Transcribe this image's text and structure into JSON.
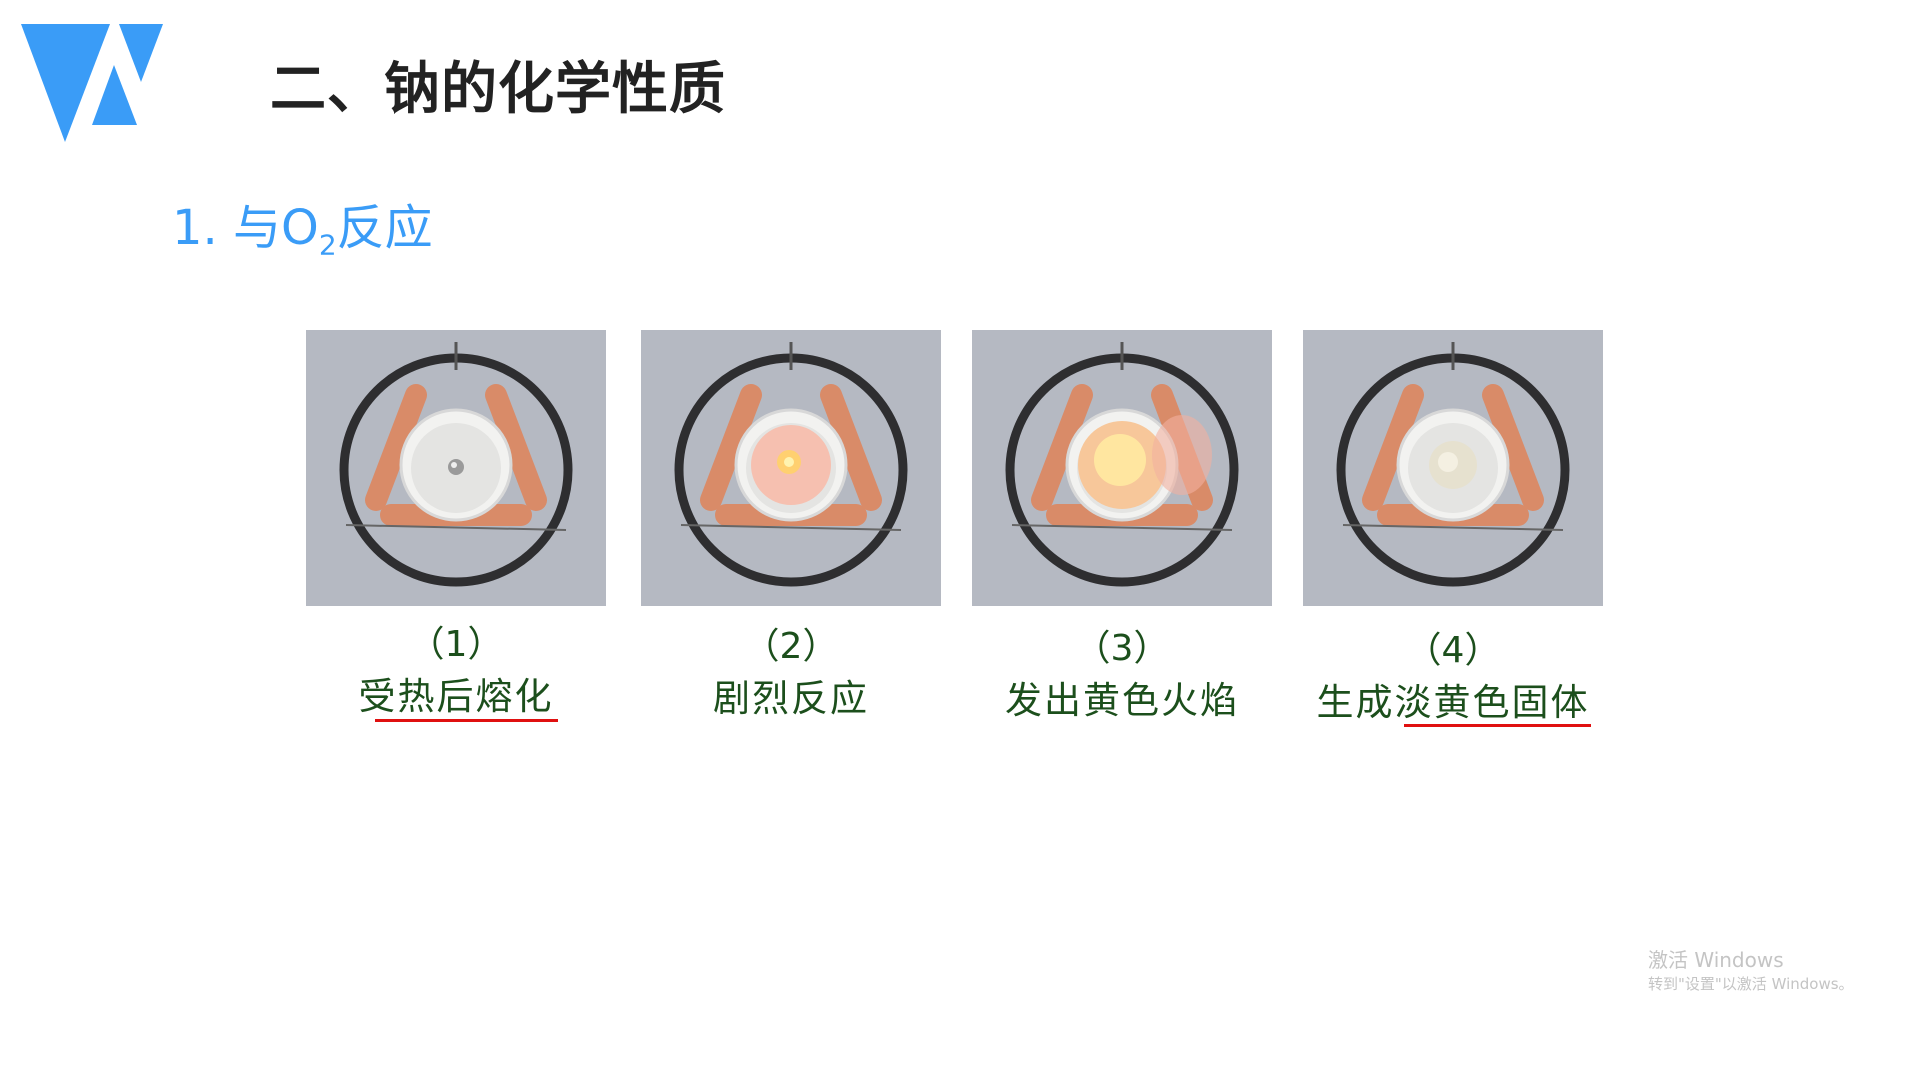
{
  "header": {
    "title": "二、钠的化学性质",
    "logo": "triangle-logo",
    "logo_color": "#3a9cf7"
  },
  "section": {
    "prefix": "1. 与O",
    "sub": "2",
    "suffix": "反应"
  },
  "steps": [
    {
      "number": "（1）",
      "caption": "受热后熔化",
      "state": "melted"
    },
    {
      "number": "（2）",
      "caption": "剧烈反应",
      "state": "reacting"
    },
    {
      "number": "（3）",
      "caption": "发出黄色火焰",
      "state": "flame"
    },
    {
      "number": "（4）",
      "caption": "生成淡黄色固体",
      "state": "solid"
    }
  ],
  "colors": {
    "caption": "#1c4f1c",
    "underline": "#e01010",
    "accent": "#3a9cf7"
  },
  "watermark": {
    "line1": "激活 Windows",
    "line2": "转到\"设置\"以激活 Windows。"
  }
}
